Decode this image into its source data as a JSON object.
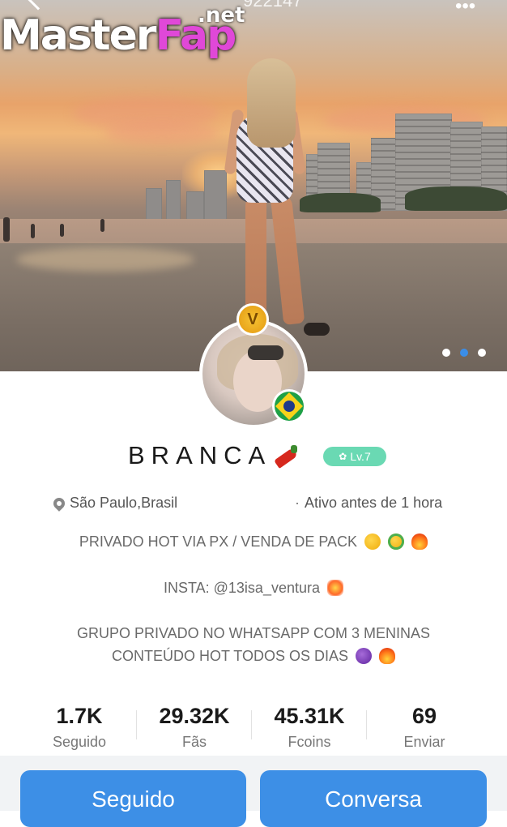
{
  "watermark": {
    "master": "Master",
    "fap": "Fap",
    "net": ".net"
  },
  "top_bar": {
    "id_text": "922147",
    "more_icon": "more-dots-icon",
    "back_icon": "back-chevron-icon"
  },
  "carousel": {
    "total": 3,
    "active_index": 1
  },
  "profile": {
    "name": "BRANCA",
    "level": "Lv.7",
    "verified_badge": "V",
    "flag": "brazil-flag-icon",
    "location": "São Paulo,Brasil",
    "activity": "Ativo antes de 1 hora"
  },
  "bio": {
    "line1": "PRIVADO HOT VIA PX / VENDA DE PACK",
    "line2": "INSTA: @13isa_ventura",
    "line3": "GRUPO PRIVADO NO WHATSAPP COM 3 MENINAS",
    "line4": "CONTEÚDO HOT TODOS OS DIAS"
  },
  "stats": [
    {
      "value": "1.7K",
      "label": "Seguido"
    },
    {
      "value": "29.32K",
      "label": "Fãs"
    },
    {
      "value": "45.31K",
      "label": "Fcoins"
    },
    {
      "value": "69",
      "label": "Enviar"
    }
  ],
  "actions": {
    "follow": "Seguido",
    "chat": "Conversa"
  },
  "colors": {
    "accent": "#3d8fe6",
    "level_badge": "#6ad9b3",
    "watermark_fap": "#e048d8"
  }
}
